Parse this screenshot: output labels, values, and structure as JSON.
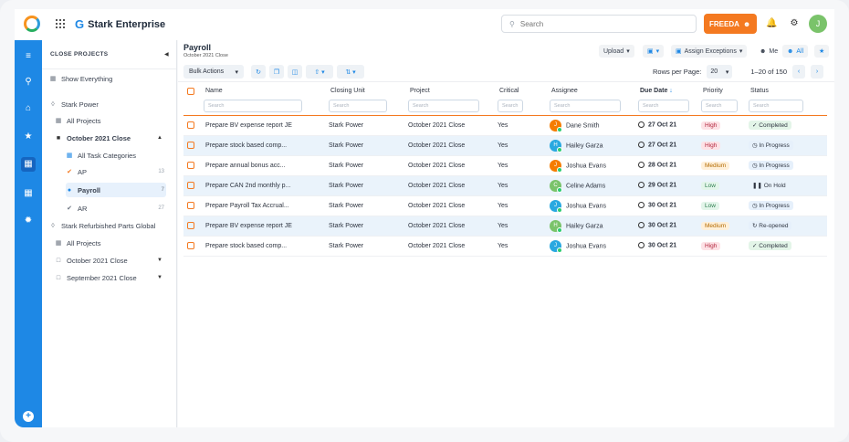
{
  "app": {
    "brand": "Stark Enterprise"
  },
  "search": {
    "placeholder": "Search"
  },
  "user": {
    "freeda_label": "FREEDA",
    "avatar_initial": "J"
  },
  "left_panel": {
    "header": "CLOSE PROJECTS",
    "items": [
      {
        "label": "Show Everything",
        "icon": "grid-icon"
      },
      {
        "label": "Stark Power",
        "icon": "tag-icon"
      },
      {
        "label": "All Projects",
        "icon": "grid-icon"
      },
      {
        "label": "October 2021 Close",
        "icon": "calendar-icon"
      },
      {
        "label": "All Task Categories",
        "icon": "grid-icon"
      },
      {
        "label": "AP",
        "count": "13",
        "icon": "check-circle-icon"
      },
      {
        "label": "Payroll",
        "count": "7",
        "icon": "check-circle-icon"
      },
      {
        "label": "AR",
        "count": "27",
        "icon": "check-circle-icon"
      },
      {
        "label": "Stark Refurbished Parts Global",
        "icon": "tag-icon"
      },
      {
        "label": "All Projects",
        "icon": "grid-icon"
      },
      {
        "label": "October 2021 Close",
        "icon": "calendar-icon"
      },
      {
        "label": "September 2021 Close",
        "icon": "calendar-icon"
      }
    ]
  },
  "page": {
    "title": "Payroll",
    "subtitle": "October 2021 Close",
    "upload_label": "Upload",
    "assign_exceptions_label": "Assign Exceptions",
    "me_label": "Me",
    "all_label": "All",
    "bulk_actions_label": "Bulk Actions",
    "rows_per_page_label": "Rows per Page:",
    "rows_per_page_value": "20",
    "range_label": "1–20 of 150"
  },
  "table": {
    "columns": [
      "Name",
      "Closing Unit",
      "Project",
      "Critical",
      "Assignee",
      "Due Date",
      "Priority",
      "Status"
    ],
    "filter_placeholder": "Search",
    "rows": [
      {
        "name": "Prepare BV expense report JE",
        "unit": "Stark Power",
        "project": "October 2021 Close",
        "critical": "Yes",
        "initial": "J",
        "assignee": "Dane Smith",
        "due": "27 Oct 21",
        "priority": "High",
        "status": "Completed"
      },
      {
        "name": "Prepare stock based comp...",
        "unit": "Stark Power",
        "project": "October 2021 Close",
        "critical": "Yes",
        "initial": "H",
        "assignee": "Hailey Garza",
        "due": "27 Oct 21",
        "priority": "High",
        "status": "In Progress"
      },
      {
        "name": "Prepare annual bonus acc...",
        "unit": "Stark Power",
        "project": "October 2021 Close",
        "critical": "Yes",
        "initial": "J",
        "assignee": "Joshua Evans",
        "due": "28 Oct 21",
        "priority": "Medium",
        "status": "In Progress"
      },
      {
        "name": "Prepare CAN 2nd monthly p...",
        "unit": "Stark Power",
        "project": "October 2021 Close",
        "critical": "Yes",
        "initial": "C",
        "assignee": "Celine Adams",
        "due": "29 Oct 21",
        "priority": "Low",
        "status": "On Hold"
      },
      {
        "name": "Prepare Payroll Tax Accrual...",
        "unit": "Stark Power",
        "project": "October 2021 Close",
        "critical": "Yes",
        "initial": "J",
        "assignee": "Joshua Evans",
        "due": "30 Oct 21",
        "priority": "Low",
        "status": "In Progress"
      },
      {
        "name": "Prepare BV expense report JE",
        "unit": "Stark Power",
        "project": "October 2021 Close",
        "critical": "Yes",
        "initial": "H",
        "assignee": "Hailey Garza",
        "due": "30 Oct 21",
        "priority": "Medium",
        "status": "Re-opened"
      },
      {
        "name": "Prepare stock based comp...",
        "unit": "Stark Power",
        "project": "October 2021 Close",
        "critical": "Yes",
        "initial": "J",
        "assignee": "Joshua Evans",
        "due": "30 Oct 21",
        "priority": "High",
        "status": "Completed"
      }
    ]
  },
  "colors": {
    "accent": "#1e88e5",
    "orange": "#f47920",
    "high": "#fde2e6",
    "medium": "#fff0d9",
    "low": "#e3f5ea",
    "avatar_orange": "#f57c00",
    "avatar_blue": "#29a8e0",
    "avatar_green": "#7ac36a"
  }
}
